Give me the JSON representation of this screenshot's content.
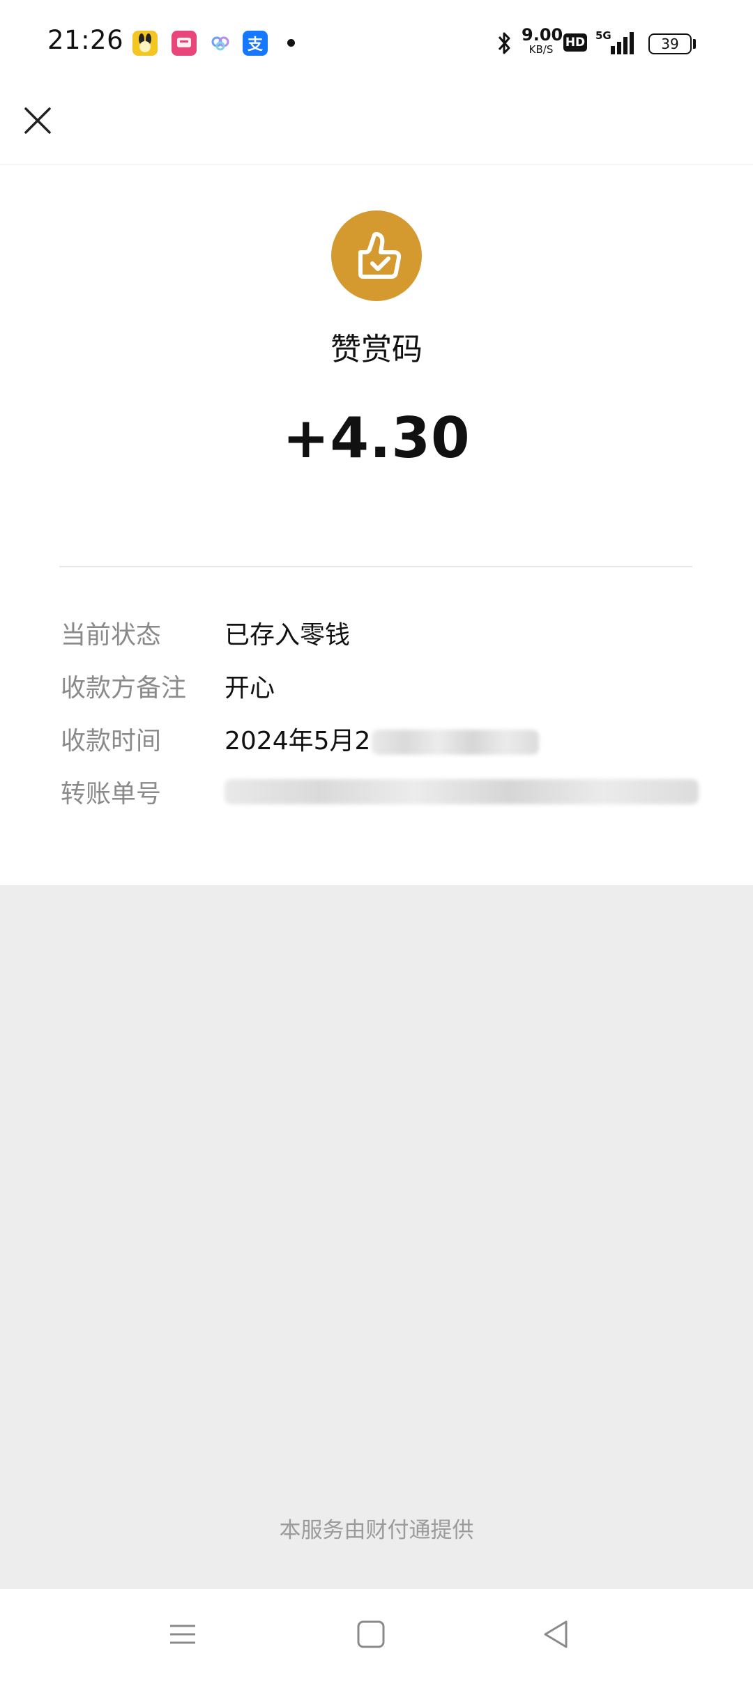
{
  "status_bar": {
    "time": "21:26",
    "speed_value": "9.00",
    "speed_unit": "KB/S",
    "hd_label": "HD",
    "network": "5G",
    "battery": "39"
  },
  "detail": {
    "icon": "thumbs-up-check-icon",
    "title": "赞赏码",
    "amount": "+4.30",
    "rows": [
      {
        "label": "当前状态",
        "value": "已存入零钱"
      },
      {
        "label": "收款方备注",
        "value": "开心"
      },
      {
        "label": "收款时间",
        "value": "2024年5月2"
      },
      {
        "label": "转账单号",
        "value": ""
      }
    ]
  },
  "footer": {
    "note": "本服务由财付通提供"
  },
  "colors": {
    "badge": "#d49a2f",
    "background_gray": "#ededed"
  }
}
